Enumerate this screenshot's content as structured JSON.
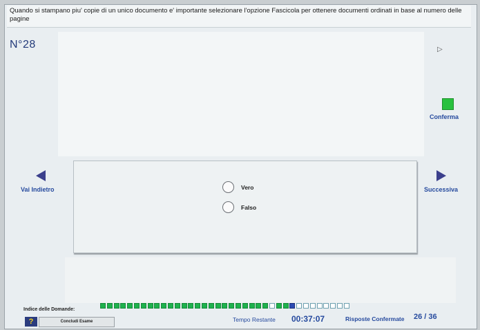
{
  "question": {
    "text": "Quando si stampano piu' copie di un unico documento e' importante selezionare l'opzione Fascicola per ottenere documenti ordinati in base al numero delle pagine",
    "number": "N°28"
  },
  "nav": {
    "confirm_label": "Conferma",
    "back_label": "Vai Indietro",
    "next_label": "Successiva"
  },
  "options": [
    {
      "label": "Vero",
      "selected": false
    },
    {
      "label": "Falso",
      "selected": false
    }
  ],
  "footer": {
    "index_label": "Indice delle Domande:",
    "help_label": "?",
    "end_exam_label": "Concludi Esame",
    "time_label": "Tempo Restante",
    "timer": "00:37:07",
    "confirmed_label": "Risposte Confermate",
    "progress": "26 / 36"
  },
  "question_index": {
    "total": 36,
    "answered": 26,
    "current": 28,
    "states": [
      "on",
      "on",
      "on",
      "on",
      "on",
      "on",
      "on",
      "on",
      "on",
      "on",
      "on",
      "on",
      "on",
      "on",
      "on",
      "on",
      "on",
      "on",
      "on",
      "on",
      "on",
      "on",
      "on",
      "on",
      "on",
      "off",
      "on",
      "on",
      "cur",
      "off",
      "off",
      "off",
      "off",
      "off",
      "off",
      "off",
      "off"
    ]
  },
  "colors": {
    "accent": "#264a9e",
    "answered": "#1fb14d",
    "current": "#2c4bb3",
    "confirm": "#29c13e"
  }
}
